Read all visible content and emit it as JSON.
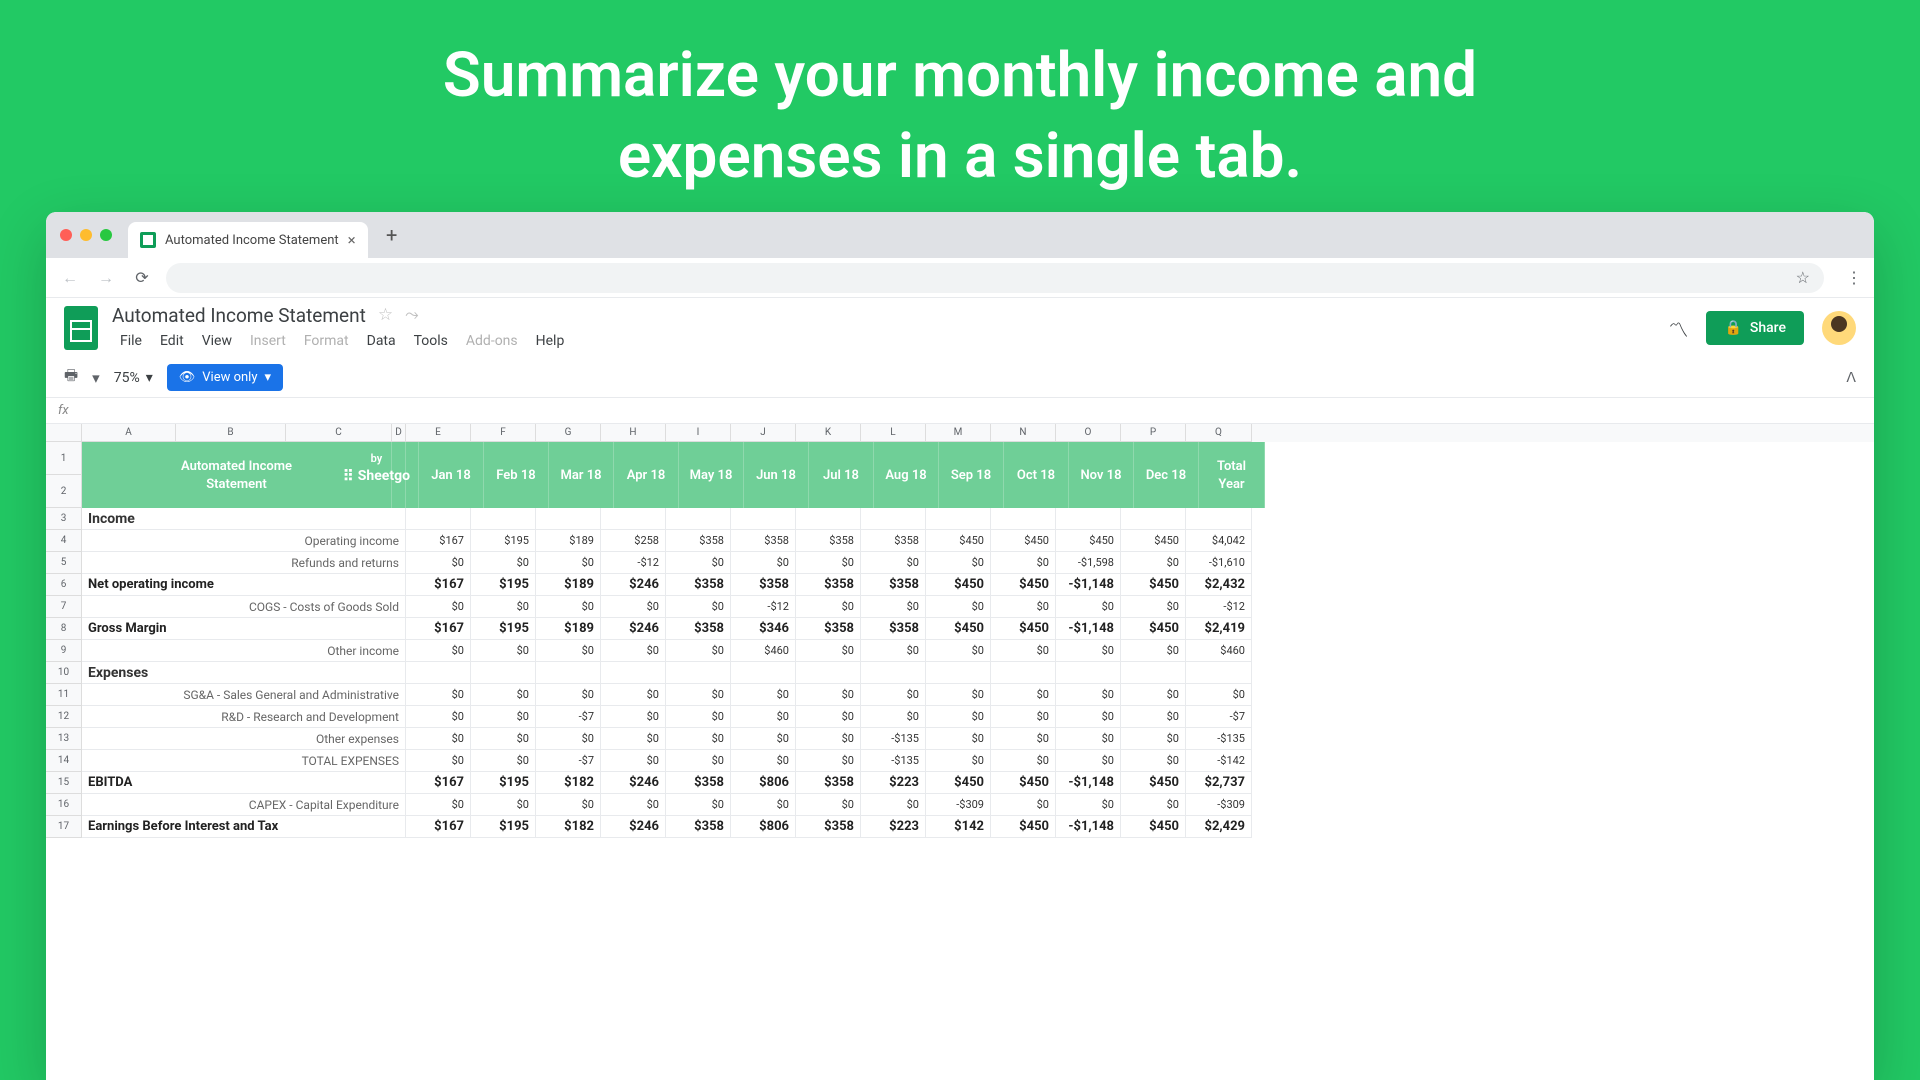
{
  "hero": {
    "title_l1": "Summarize your monthly income and",
    "title_l2": "expenses in a single tab."
  },
  "tab": {
    "title": "Automated Income Statement"
  },
  "doc": {
    "title": "Automated Income Statement"
  },
  "menu": {
    "file": "File",
    "edit": "Edit",
    "view": "View",
    "insert": "Insert",
    "format": "Format",
    "data": "Data",
    "tools": "Tools",
    "addons": "Add-ons",
    "help": "Help"
  },
  "toolbar": {
    "zoom": "75%",
    "viewonly": "View only"
  },
  "share": {
    "label": "Share"
  },
  "fx": {
    "label": "fx"
  },
  "cols": [
    "A",
    "B",
    "C",
    "D",
    "E",
    "F",
    "G",
    "H",
    "I",
    "J",
    "K",
    "L",
    "M",
    "N",
    "O",
    "P",
    "Q"
  ],
  "header": {
    "title_l1": "Automated",
    "title_l2": "Income",
    "title_l3": "Statement",
    "by": "by",
    "brand": "Sheetgo"
  },
  "months": [
    "Jan 18",
    "Feb 18",
    "Mar 18",
    "Apr 18",
    "May 18",
    "Jun 18",
    "Jul 18",
    "Aug 18",
    "Sep 18",
    "Oct 18",
    "Nov 18",
    "Dec 18"
  ],
  "totalhdr": {
    "l1": "Total",
    "l2": "Year"
  },
  "rows": [
    {
      "n": "3",
      "type": "section",
      "label": "Income"
    },
    {
      "n": "4",
      "type": "detail",
      "label": "Operating income",
      "vals": [
        "$167",
        "$195",
        "$189",
        "$258",
        "$358",
        "$358",
        "$358",
        "$358",
        "$450",
        "$450",
        "$450",
        "$450",
        "$4,042"
      ]
    },
    {
      "n": "5",
      "type": "detail",
      "label": "Refunds and returns",
      "vals": [
        "$0",
        "$0",
        "$0",
        "-$12",
        "$0",
        "$0",
        "$0",
        "$0",
        "$0",
        "$0",
        "-$1,598",
        "$0",
        "-$1,610"
      ]
    },
    {
      "n": "6",
      "type": "bold",
      "label": "Net operating income",
      "vals": [
        "$167",
        "$195",
        "$189",
        "$246",
        "$358",
        "$358",
        "$358",
        "$358",
        "$450",
        "$450",
        "-$1,148",
        "$450",
        "$2,432"
      ]
    },
    {
      "n": "7",
      "type": "detail",
      "label": "COGS - Costs of Goods Sold",
      "vals": [
        "$0",
        "$0",
        "$0",
        "$0",
        "$0",
        "-$12",
        "$0",
        "$0",
        "$0",
        "$0",
        "$0",
        "$0",
        "-$12"
      ]
    },
    {
      "n": "8",
      "type": "bold",
      "label": "Gross Margin",
      "vals": [
        "$167",
        "$195",
        "$189",
        "$246",
        "$358",
        "$346",
        "$358",
        "$358",
        "$450",
        "$450",
        "-$1,148",
        "$450",
        "$2,419"
      ]
    },
    {
      "n": "9",
      "type": "detail",
      "label": "Other income",
      "vals": [
        "$0",
        "$0",
        "$0",
        "$0",
        "$0",
        "$460",
        "$0",
        "$0",
        "$0",
        "$0",
        "$0",
        "$0",
        "$460"
      ]
    },
    {
      "n": "10",
      "type": "section",
      "label": "Expenses"
    },
    {
      "n": "11",
      "type": "detail",
      "label": "SG&A - Sales General and Administrative",
      "vals": [
        "$0",
        "$0",
        "$0",
        "$0",
        "$0",
        "$0",
        "$0",
        "$0",
        "$0",
        "$0",
        "$0",
        "$0",
        "$0"
      ]
    },
    {
      "n": "12",
      "type": "detail",
      "label": "R&D - Research and Development",
      "vals": [
        "$0",
        "$0",
        "-$7",
        "$0",
        "$0",
        "$0",
        "$0",
        "$0",
        "$0",
        "$0",
        "$0",
        "$0",
        "-$7"
      ]
    },
    {
      "n": "13",
      "type": "detail",
      "label": "Other expenses",
      "vals": [
        "$0",
        "$0",
        "$0",
        "$0",
        "$0",
        "$0",
        "$0",
        "-$135",
        "$0",
        "$0",
        "$0",
        "$0",
        "-$135"
      ]
    },
    {
      "n": "14",
      "type": "detail",
      "label": "TOTAL EXPENSES",
      "vals": [
        "$0",
        "$0",
        "-$7",
        "$0",
        "$0",
        "$0",
        "$0",
        "-$135",
        "$0",
        "$0",
        "$0",
        "$0",
        "-$142"
      ]
    },
    {
      "n": "15",
      "type": "bold",
      "label": "EBITDA",
      "vals": [
        "$167",
        "$195",
        "$182",
        "$246",
        "$358",
        "$806",
        "$358",
        "$223",
        "$450",
        "$450",
        "-$1,148",
        "$450",
        "$2,737"
      ]
    },
    {
      "n": "16",
      "type": "detail",
      "label": "CAPEX - Capital Expenditure",
      "vals": [
        "$0",
        "$0",
        "$0",
        "$0",
        "$0",
        "$0",
        "$0",
        "$0",
        "-$309",
        "$0",
        "$0",
        "$0",
        "-$309"
      ]
    },
    {
      "n": "17",
      "type": "bold",
      "label": "Earnings Before Interest and Tax",
      "vals": [
        "$167",
        "$195",
        "$182",
        "$246",
        "$358",
        "$806",
        "$358",
        "$223",
        "$142",
        "$450",
        "-$1,148",
        "$450",
        "$2,429"
      ]
    }
  ]
}
